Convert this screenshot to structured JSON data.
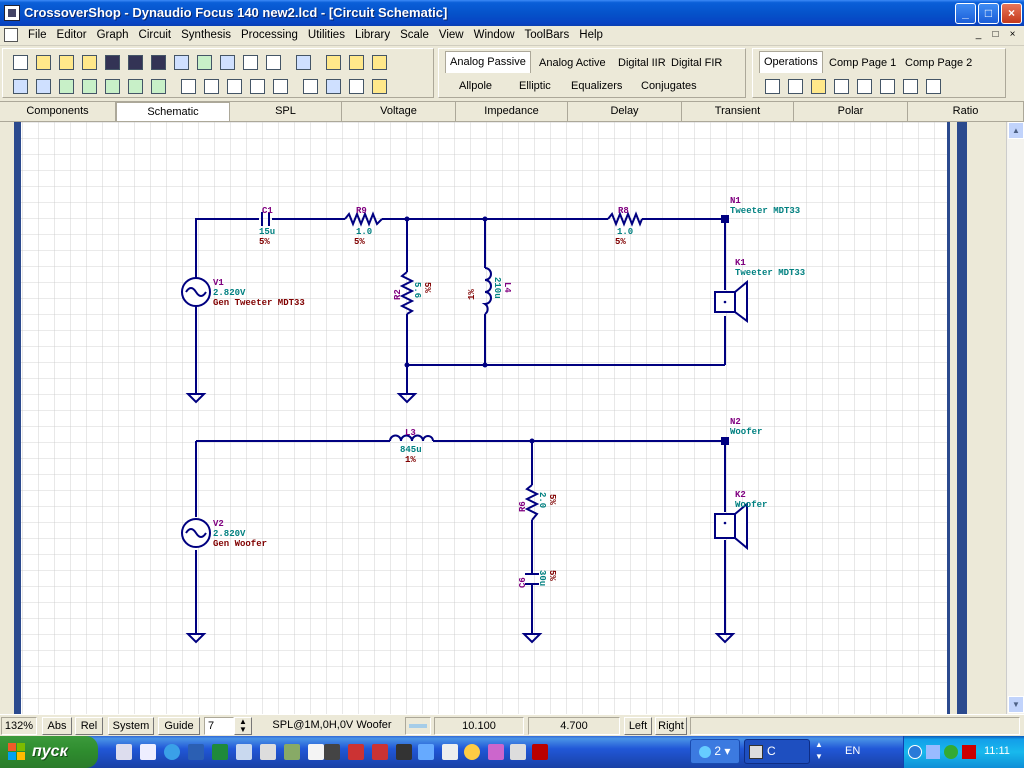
{
  "window": {
    "title": "CrossoverShop - Dynaudio Focus 140 new2.lcd - [Circuit Schematic]",
    "min": "_",
    "max": "□",
    "close": "×"
  },
  "menubar": {
    "items": [
      "File",
      "Editor",
      "Graph",
      "Circuit",
      "Synthesis",
      "Processing",
      "Utilities",
      "Library",
      "Scale",
      "View",
      "Window",
      "ToolBars",
      "Help"
    ],
    "mdi": [
      "_",
      "□",
      "×"
    ]
  },
  "panel_tabs": {
    "row1": [
      "Analog Passive",
      "Analog Active",
      "Digital IIR",
      "Digital FIR"
    ],
    "row2": [
      "Allpole",
      "Elliptic",
      "Equalizers",
      "Conjugates"
    ],
    "ops": [
      "Operations",
      "Comp Page 1",
      "Comp Page 2"
    ]
  },
  "view_tabs": [
    "Components",
    "Schematic",
    "SPL",
    "Voltage",
    "Impedance",
    "Delay",
    "Transient",
    "Polar",
    "Ratio"
  ],
  "schematic": {
    "C1": {
      "name": "C1",
      "value": "15u",
      "tol": "5%"
    },
    "R9": {
      "name": "R9",
      "value": "1.0",
      "tol": "5%"
    },
    "R8": {
      "name": "R8",
      "value": "1.0",
      "tol": "5%"
    },
    "R2": {
      "name": "R2",
      "value": "5.6",
      "tol": "5%"
    },
    "L4": {
      "name": "L4",
      "value": "210u",
      "tol": "1%"
    },
    "V1": {
      "name": "V1",
      "value": "2.820V",
      "label": "Gen Tweeter MDT33"
    },
    "N1": {
      "name": "N1",
      "label": "Tweeter MDT33"
    },
    "K1": {
      "name": "K1",
      "label": "Tweeter MDT33"
    },
    "L3": {
      "name": "L3",
      "value": "845u",
      "tol": "1%"
    },
    "N2": {
      "name": "N2",
      "label": "Woofer"
    },
    "K2": {
      "name": "K2",
      "label": "Woofer"
    },
    "V2": {
      "name": "V2",
      "value": "2.820V",
      "label": "Gen Woofer"
    },
    "R6": {
      "name": "R6",
      "value": "2.0",
      "tol": "5%"
    },
    "C6": {
      "name": "C6",
      "value": "30u",
      "tol": "5%"
    }
  },
  "statusbar": {
    "zoom": "132%",
    "abs": "Abs",
    "rel": "Rel",
    "system": "System",
    "guide": "Guide",
    "guide_value": "7",
    "trace": "SPL@1M,0H,0V Woofer",
    "val1": "10.100",
    "val2": "4.700",
    "left": "Left",
    "right": "Right"
  },
  "taskbar": {
    "start": "пуск",
    "group_count": "2",
    "app_label": "C",
    "lang": "EN",
    "clock": "11:11"
  },
  "colors": {
    "title_blue": "#0551c9",
    "wire": "#000080",
    "comp_name": "#800080",
    "comp_value": "#008080",
    "comp_tol": "#800000",
    "node_dot": "#000080"
  }
}
